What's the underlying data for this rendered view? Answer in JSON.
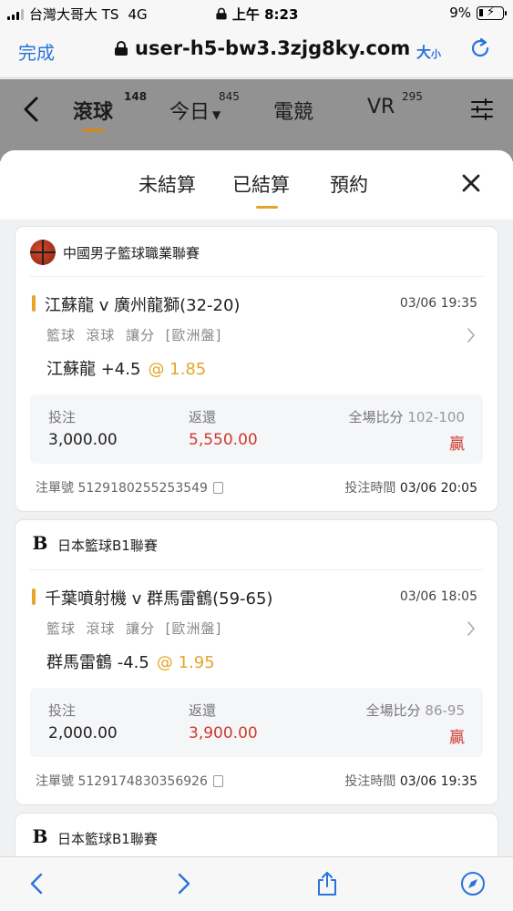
{
  "status": {
    "carrier": "台灣大哥大 TS",
    "network": "4G",
    "time": "上午 8:23",
    "battery": "9%"
  },
  "browser": {
    "done": "完成",
    "url": "user-h5-bw3.3zjg8ky.com",
    "text_size": "大",
    "text_size_small": "小"
  },
  "nav": {
    "tabs": [
      {
        "label": "滾球",
        "count": "148",
        "active": true
      },
      {
        "label": "今日",
        "count": "845"
      },
      {
        "label": "電競",
        "count": ""
      },
      {
        "label": "VR",
        "count": "295"
      }
    ]
  },
  "sheet": {
    "tabs": [
      {
        "label": "未結算"
      },
      {
        "label": "已結算",
        "active": true
      },
      {
        "label": "預約"
      }
    ]
  },
  "bets": [
    {
      "league": "中國男子籃球職業聯賽",
      "match": "江蘇龍 v 廣州龍獅(32-20)",
      "time": "03/06 19:35",
      "meta": "籃球  滾球  讓分  [歐洲盤]",
      "pick": "江蘇龍 +4.5",
      "odds": "@ 1.85",
      "stake_label": "投注",
      "stake": "3,000.00",
      "return_label": "返還",
      "return": "5,550.00",
      "score_label": "全場比分",
      "score": "102-100",
      "result": "贏",
      "ticket_label": "注單號",
      "ticket": "5129180255253549",
      "bet_time_label": "投注時間",
      "bet_time": "03/06 20:05"
    },
    {
      "league": "日本籃球B1聯賽",
      "match": "千葉噴射機 v 群馬雷鶴(59-65)",
      "time": "03/06 18:05",
      "meta": "籃球  滾球  讓分  [歐洲盤]",
      "pick": "群馬雷鶴 -4.5",
      "odds": "@ 1.95",
      "stake_label": "投注",
      "stake": "2,000.00",
      "return_label": "返還",
      "return": "3,900.00",
      "score_label": "全場比分",
      "score": "86-95",
      "result": "贏",
      "ticket_label": "注單號",
      "ticket": "5129174830356926",
      "bet_time_label": "投注時間",
      "bet_time": "03/06 19:35"
    },
    {
      "league": "日本籃球B1聯賽",
      "logo_text": "B"
    }
  ]
}
